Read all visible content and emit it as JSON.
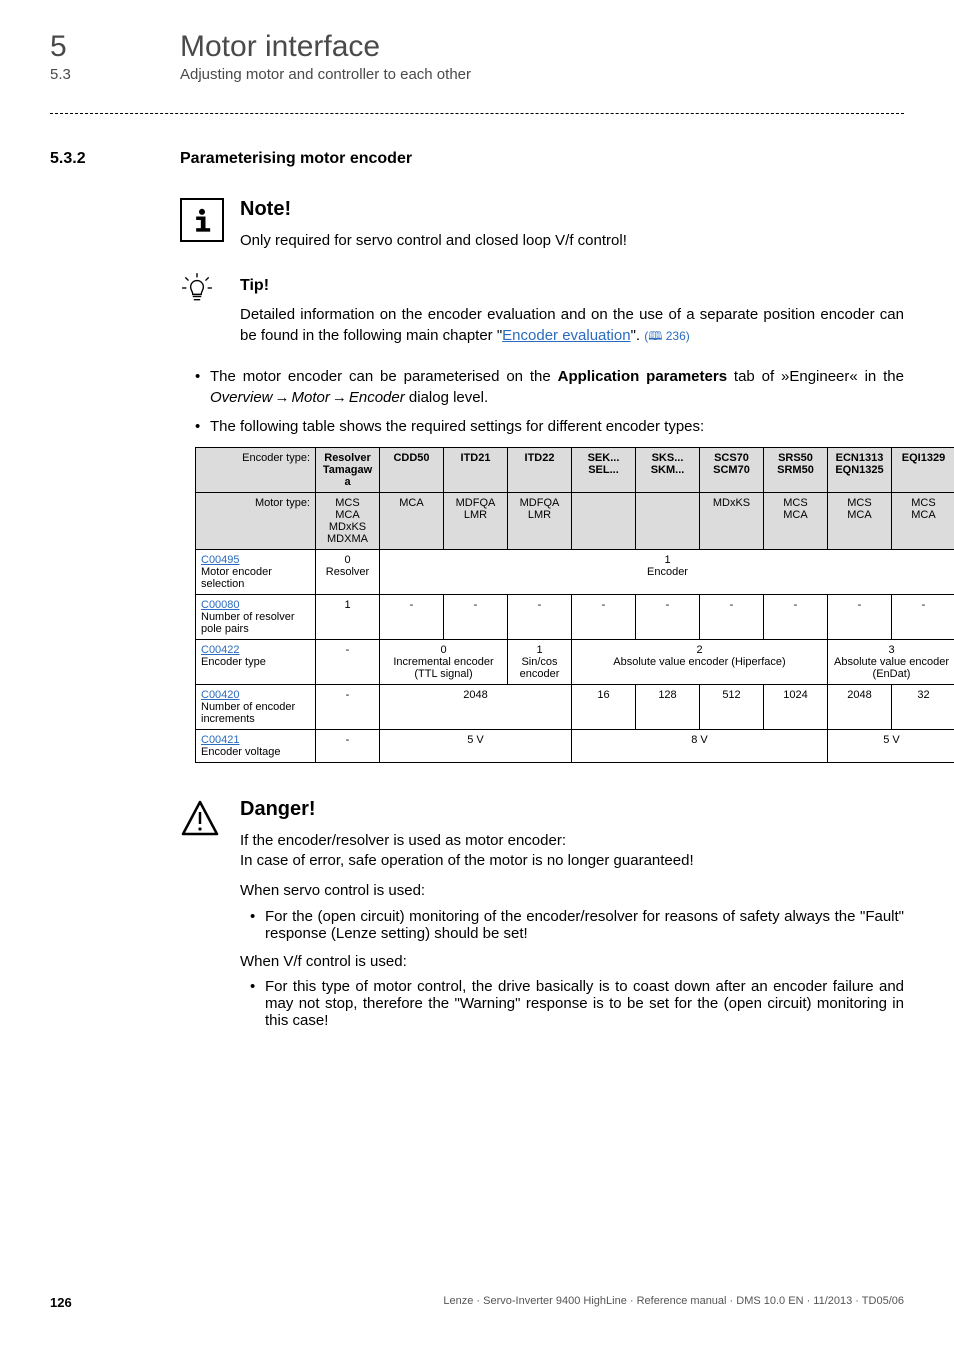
{
  "header": {
    "chapter_num": "5",
    "chapter_title": "Motor interface",
    "sub_num": "5.3",
    "sub_title": "Adjusting motor and controller to each other"
  },
  "section": {
    "num": "5.3.2",
    "title": "Parameterising motor encoder"
  },
  "note": {
    "title": "Note!",
    "text": "Only required for servo control and closed loop V/f control!"
  },
  "tip": {
    "title": "Tip!",
    "text_prefix": "Detailed information on the encoder evaluation and on the use of a separate position encoder can be found in the following main chapter \"",
    "link": "Encoder evaluation",
    "text_suffix": "\". ",
    "ref": "(🕮 236)"
  },
  "bullets": {
    "b1_a": "The motor encoder can be parameterised on the ",
    "b1_bold": "Application parameters",
    "b1_b": " tab of »Engineer« in the ",
    "b1_i1": "Overview",
    "b1_i2": "Motor",
    "b1_i3": "Encoder",
    "b1_c": " dialog level.",
    "b2": "The following table shows the required settings for different encoder types:"
  },
  "table": {
    "row_header_enc": "Encoder type:",
    "row_header_motor": "Motor type:",
    "cols": [
      {
        "enc": "Resolver Tamagawa",
        "motor": "MCS\nMCA\nMDxKS\nMDXMA"
      },
      {
        "enc": "CDD50",
        "motor": "MCA"
      },
      {
        "enc": "ITD21",
        "motor": "MDFQA\nLMR"
      },
      {
        "enc": "ITD22",
        "motor": "MDFQA\nLMR"
      },
      {
        "enc": "SEK...\nSEL...",
        "motor": ""
      },
      {
        "enc": "SKS...\nSKM...",
        "motor": ""
      },
      {
        "enc": "SCS70\nSCM70",
        "motor": "MDxKS"
      },
      {
        "enc": "SRS50\nSRM50",
        "motor": "MCS\nMCA"
      },
      {
        "enc": "ECN1313\nEQN1325",
        "motor": "MCS\nMCA"
      },
      {
        "enc": "EQI1329",
        "motor": "MCS\nMCA"
      }
    ],
    "rows": {
      "r1": {
        "code": "C00495",
        "label": "Motor encoder selection",
        "c1": "0\nResolver",
        "merged_rest": "1\nEncoder"
      },
      "r2": {
        "code": "C00080",
        "label": "Number of resolver pole pairs",
        "c1": "1",
        "dash": "-"
      },
      "r3": {
        "code": "C00422",
        "label": "Encoder type",
        "c1": "-",
        "g1": "0\nIncremental encoder (TTL signal)",
        "g2": "1\nSin/cos encoder",
        "g3": "2\nAbsolute value encoder (Hiperface)",
        "g4": "3\nAbsolute value encoder (EnDat)"
      },
      "r4": {
        "code": "C00420",
        "label": "Number of encoder increments",
        "c1": "-",
        "g1": "2048",
        "v5": "16",
        "v6": "128",
        "v7": "512",
        "v8": "1024",
        "v9": "2048",
        "v10": "32"
      },
      "r5": {
        "code": "C00421",
        "label": "Encoder voltage",
        "c1": "-",
        "g1": "5 V",
        "g2": "8 V",
        "g3": "5 V"
      }
    }
  },
  "danger": {
    "title": "Danger!",
    "p1": "If the encoder/resolver is used as motor encoder:\nIn case of error, safe operation of the motor is no longer guaranteed!",
    "p2": "When servo control is used:",
    "b1": "For the (open circuit) monitoring of the encoder/resolver for reasons of safety always the \"Fault\" response (Lenze setting) should be set!",
    "p3": "When V/f control is used:",
    "b2": "For this type of motor control, the drive basically is to coast down after an encoder failure and may not stop, therefore the \"Warning\" response is to be set for the (open circuit) monitoring in this case!"
  },
  "footer": {
    "page": "126",
    "meta": "Lenze · Servo-Inverter 9400 HighLine · Reference manual · DMS 10.0 EN · 11/2013 · TD05/06"
  }
}
